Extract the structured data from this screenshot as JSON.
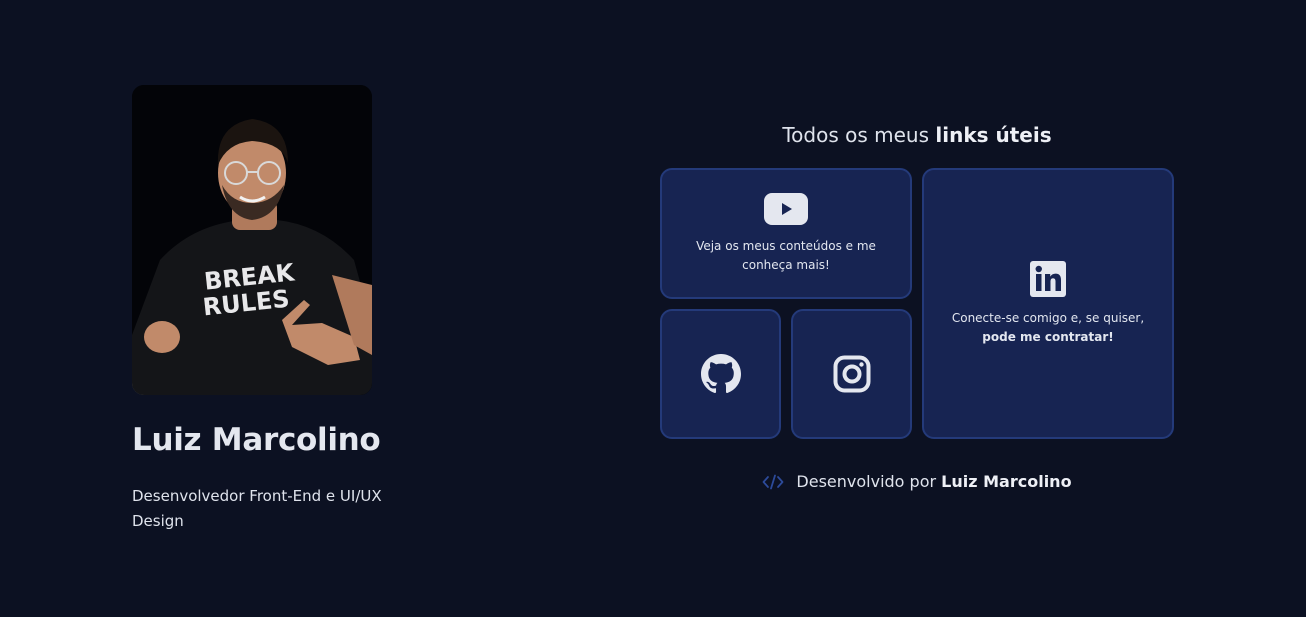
{
  "profile": {
    "name": "Luiz Marcolino",
    "role": "Desenvolvedor Front-End e UI/UX Design",
    "shirt_text_line1": "BREAK",
    "shirt_text_line2": "RULES"
  },
  "links": {
    "title_prefix": "Todos os meus ",
    "title_bold": "links úteis",
    "youtube": {
      "icon": "youtube-icon",
      "text": "Veja os meus conteúdos e me conheça mais!"
    },
    "github": {
      "icon": "github-icon"
    },
    "instagram": {
      "icon": "instagram-icon"
    },
    "linkedin": {
      "icon": "linkedin-icon",
      "text": "Conecte-se comigo e, se quiser,",
      "text_bold": "pode me contratar!"
    }
  },
  "footer": {
    "icon": "code-icon",
    "prefix": "Desenvolvido por ",
    "author": "Luiz Marcolino"
  },
  "colors": {
    "background": "#0c1122",
    "card": "#172452",
    "card_border": "#243a7a",
    "text": "#e2e6f0"
  }
}
